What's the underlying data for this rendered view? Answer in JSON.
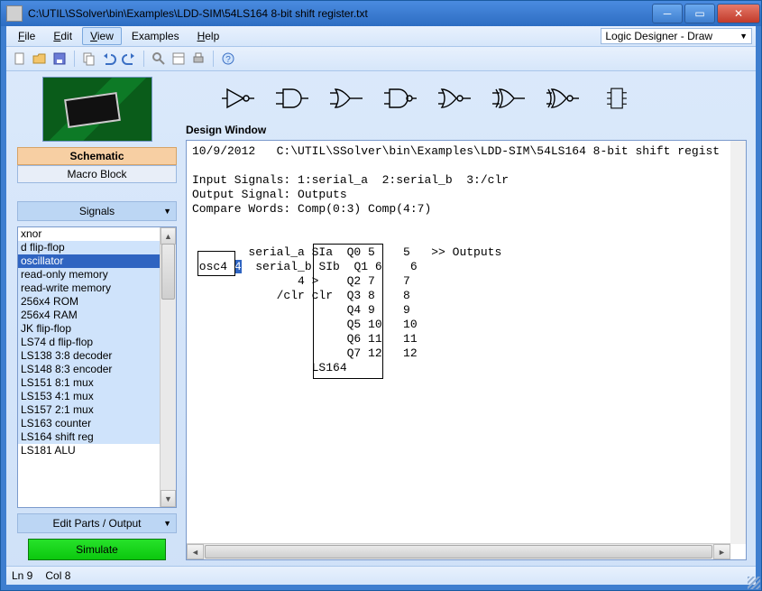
{
  "window": {
    "title": "C:\\UTIL\\SSolver\\bin\\Examples\\LDD-SIM\\54LS164 8-bit shift register.txt"
  },
  "menubar": {
    "file": "File",
    "edit": "Edit",
    "view": "View",
    "examples": "Examples",
    "help": "Help",
    "active": "view",
    "mode": "Logic Designer - Draw"
  },
  "toolbar_icons": [
    "new",
    "open",
    "save",
    "",
    "copy",
    "undo",
    "redo",
    "",
    "find",
    "properties",
    "print",
    "",
    "help"
  ],
  "sidebar": {
    "tabs": {
      "schematic": "Schematic",
      "macro": "Macro Block"
    },
    "signals_label": "Signals",
    "parts": [
      {
        "label": "xnor",
        "state": "white"
      },
      {
        "label": "d flip-flop",
        "state": "hl"
      },
      {
        "label": "oscillator",
        "state": "sel"
      },
      {
        "label": "read-only memory",
        "state": "hl"
      },
      {
        "label": "read-write memory",
        "state": "hl"
      },
      {
        "label": "256x4 ROM",
        "state": "hl"
      },
      {
        "label": "256x4 RAM",
        "state": "hl"
      },
      {
        "label": "JK flip-flop",
        "state": "hl"
      },
      {
        "label": "LS74 d flip-flop",
        "state": "hl"
      },
      {
        "label": "LS138 3:8 decoder",
        "state": "hl"
      },
      {
        "label": "LS148 8:3 encoder",
        "state": "hl"
      },
      {
        "label": "LS151 8:1 mux",
        "state": "hl"
      },
      {
        "label": "LS153 4:1 mux",
        "state": "hl"
      },
      {
        "label": "LS157 2:1 mux",
        "state": "hl"
      },
      {
        "label": "LS163 counter",
        "state": "hl"
      },
      {
        "label": "LS164 shift reg",
        "state": "hl"
      },
      {
        "label": "LS181 ALU",
        "state": "white"
      }
    ],
    "edit_parts_label": "Edit Parts / Output",
    "simulate_label": "Simulate"
  },
  "design": {
    "title": "Design Window",
    "header_date": "10/9/2012",
    "header_path": "C:\\UTIL\\SSolver\\bin\\Examples\\LDD-SIM\\54LS164 8-bit shift regist",
    "input_line": "Input Signals: 1:serial_a  2:serial_b  3:/clr",
    "output_line": "Output Signal: Outputs",
    "compare_line": "Compare Words: Comp(0:3) Comp(4:7)",
    "osc_label": "osc4",
    "osc_hl": "4",
    "sig1": "serial_a",
    "sig2": "serial_b",
    "sig3": "4",
    "sig4": "/clr",
    "chip_name": "LS164",
    "pins_left": [
      "SIa",
      "SIb",
      ">",
      "clr",
      "",
      "",
      "",
      ""
    ],
    "pins_right": [
      "Q0",
      "Q1",
      "Q2",
      "Q3",
      "Q4",
      "Q5",
      "Q6",
      "Q7"
    ],
    "outs_a": [
      "5",
      "6",
      "7",
      "8",
      "9",
      "10",
      "11",
      "12"
    ],
    "outs_b": [
      "5",
      "6",
      "7",
      "8",
      "9",
      "10",
      "11",
      "12"
    ],
    "out_suffix": ">> Outputs"
  },
  "statusbar": {
    "ln": "Ln 9",
    "col": "Col 8"
  },
  "colors": {
    "accent": "#3e7ecf",
    "highlight": "#2f64c1",
    "tab_active": "#f7cfa3",
    "sim_green": "#0bc70e"
  }
}
